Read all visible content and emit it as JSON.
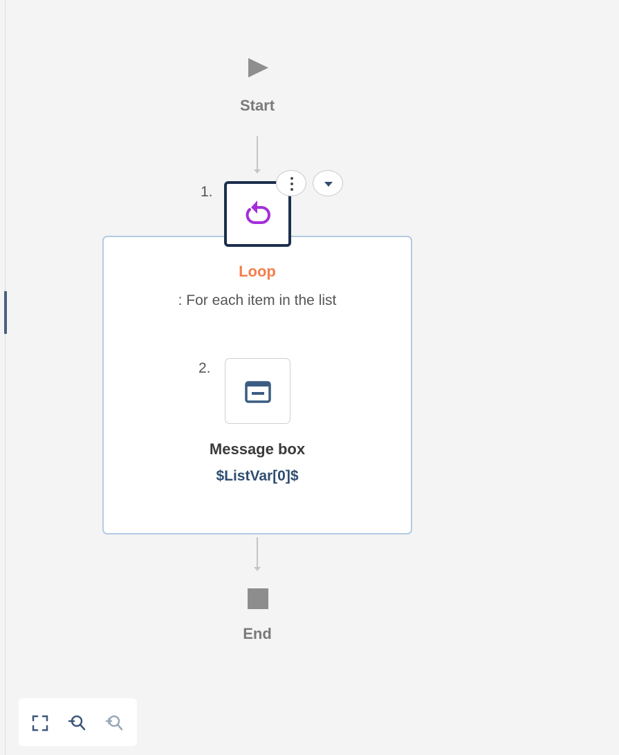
{
  "flow": {
    "start_label": "Start",
    "end_label": "End",
    "steps": [
      {
        "number": "1.",
        "title": "Loop",
        "subtitle": ": For each item in the list",
        "icon": "loop-icon"
      },
      {
        "number": "2.",
        "title": "Message box",
        "subtitle": "$ListVar[0]$",
        "icon": "message-box-icon"
      }
    ]
  },
  "toolbar": {
    "icons": [
      "fit-screen-icon",
      "zoom-out-icon",
      "zoom-in-icon"
    ]
  },
  "colors": {
    "loop_title": "#f47e4c",
    "loop_icon": "#a42fd9",
    "message_subtitle": "#2f4d70",
    "selected_node_border": "#1d2f4d",
    "container_border": "#b3cae4"
  }
}
